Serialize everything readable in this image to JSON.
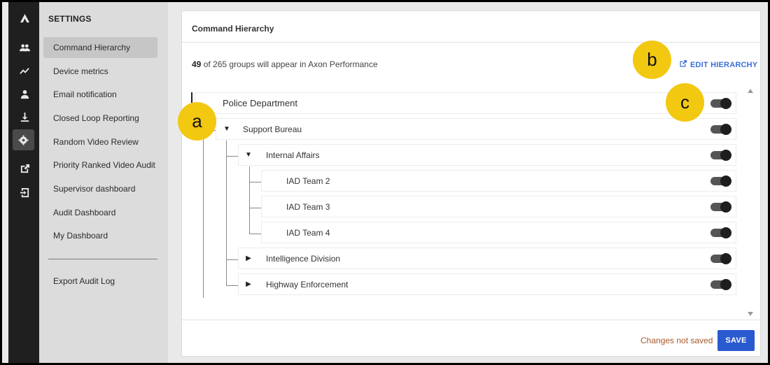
{
  "rail": {
    "icons": [
      "logo-icon",
      "people-icon",
      "trend-icon",
      "person-icon",
      "download-icon",
      "gear-icon",
      "external-link-icon",
      "sign-in-icon"
    ]
  },
  "sidebar": {
    "heading": "SETTINGS",
    "items": [
      {
        "label": "Command Hierarchy",
        "selected": true
      },
      {
        "label": "Device metrics"
      },
      {
        "label": "Email notification"
      },
      {
        "label": "Closed Loop Reporting"
      },
      {
        "label": "Random Video Review"
      },
      {
        "label": "Priority Ranked Video Audit"
      },
      {
        "label": "Supervisor dashboard"
      },
      {
        "label": "Audit Dashboard"
      },
      {
        "label": "My Dashboard"
      }
    ],
    "footer_item": "Export Audit Log"
  },
  "main": {
    "title": "Command Hierarchy",
    "summary_count": "49",
    "summary_text": " of 265 groups will appear in Axon Performance",
    "edit_label": "EDIT HIERARCHY",
    "tree": [
      {
        "label": "Police Department",
        "enabled": true
      },
      {
        "label": "Support Bureau",
        "expanded": true,
        "enabled": true
      },
      {
        "label": "Internal Affairs",
        "expanded": true,
        "enabled": true
      },
      {
        "label": "IAD Team 2",
        "enabled": true
      },
      {
        "label": "IAD Team 3",
        "enabled": true
      },
      {
        "label": "IAD Team 4",
        "enabled": true
      },
      {
        "label": "Intelligence Division",
        "expanded": false,
        "enabled": true
      },
      {
        "label": "Highway Enforcement",
        "expanded": false,
        "enabled": true
      }
    ],
    "status": "Changes not saved",
    "save_label": "SAVE"
  },
  "callouts": [
    "a",
    "b",
    "c"
  ],
  "colors": {
    "accent": "#2a5ad0",
    "link": "#3a6fd8",
    "callout": "#f2c811",
    "status": "#a55a2a"
  }
}
